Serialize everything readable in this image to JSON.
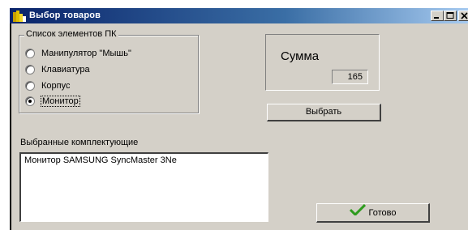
{
  "window": {
    "title": "Выбор товаров"
  },
  "titlebar_buttons": [
    {
      "name": "minimize",
      "icon": "minimize-icon"
    },
    {
      "name": "maximize",
      "icon": "maximize-icon"
    },
    {
      "name": "close",
      "icon": "close-icon"
    }
  ],
  "group": {
    "label": "Список элементов ПК",
    "options": [
      {
        "label": "Манипулятор \"Мышь\"",
        "checked": false
      },
      {
        "label": "Клавиатура",
        "checked": false
      },
      {
        "label": "Корпус",
        "checked": false
      },
      {
        "label": "Монитор",
        "checked": true
      }
    ]
  },
  "sum": {
    "label": "Сумма",
    "value": "165"
  },
  "buttons": {
    "select_label": "Выбрать",
    "done_label": "Готово",
    "done_icon": "checkmark-icon"
  },
  "selected": {
    "label": "Выбранные комплектующие",
    "items": [
      "Монитор SAMSUNG SyncMaster 3Ne"
    ]
  },
  "colors": {
    "titlebar_start": "#0a246a",
    "titlebar_end": "#a6caf0",
    "window_bg": "#d4d0c8",
    "check_green": "#2e9b1e"
  }
}
